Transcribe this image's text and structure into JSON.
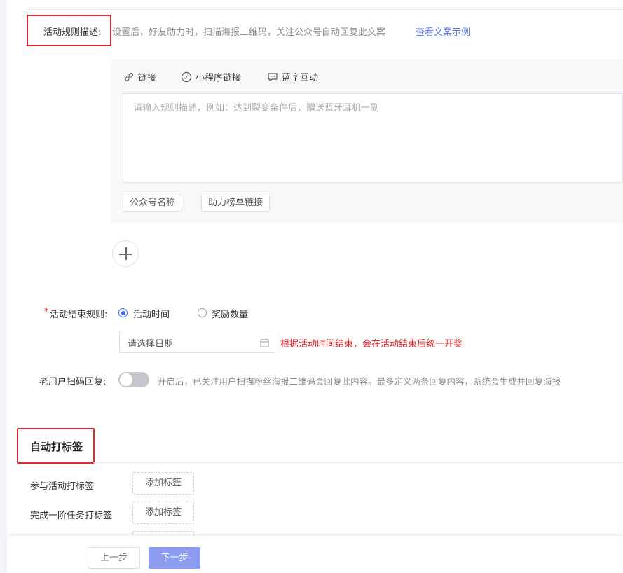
{
  "rule_desc": {
    "label": "活动规则描述:",
    "hint": "设置后，好友助力时，扫描海报二维码，关注公众号自动回复此文案",
    "example_link": "查看文案示例"
  },
  "editor": {
    "toolbar": {
      "link": "链接",
      "miniprogram_link": "小程序链接",
      "blue_text": "蓝字互动"
    },
    "placeholder": "请输入规则描述，例如：达到裂变条件后，赠送蓝牙耳机一副",
    "chips": [
      "公众号名称",
      "助力榜单链接"
    ]
  },
  "end_rule": {
    "required_mark": "*",
    "label": "活动结束规则:",
    "options": [
      "活动时间",
      "奖励数量"
    ],
    "selected": "活动时间",
    "date_placeholder": "请选择日期",
    "warning": "根据活动时间结束，会在活动结束后统一开奖"
  },
  "old_user_reply": {
    "label": "老用户扫码回复:",
    "enabled": false,
    "hint": "开启后，已关注用户扫描粉丝海报二维码会回复此内容。最多定义两条回复内容，系统会生成并回复海报"
  },
  "auto_tag": {
    "title": "自动打标签",
    "rows": [
      {
        "label": "参与活动打标签",
        "button": "添加标签"
      },
      {
        "label": "完成一阶任务打标签",
        "button": "添加标签"
      }
    ]
  },
  "footer": {
    "prev": "上一步",
    "next": "下一步"
  },
  "colors": {
    "accent": "#5b73e8",
    "primary_button": "#8c9cf0",
    "warning": "#e3262b",
    "highlight_box": "#e3262b"
  }
}
